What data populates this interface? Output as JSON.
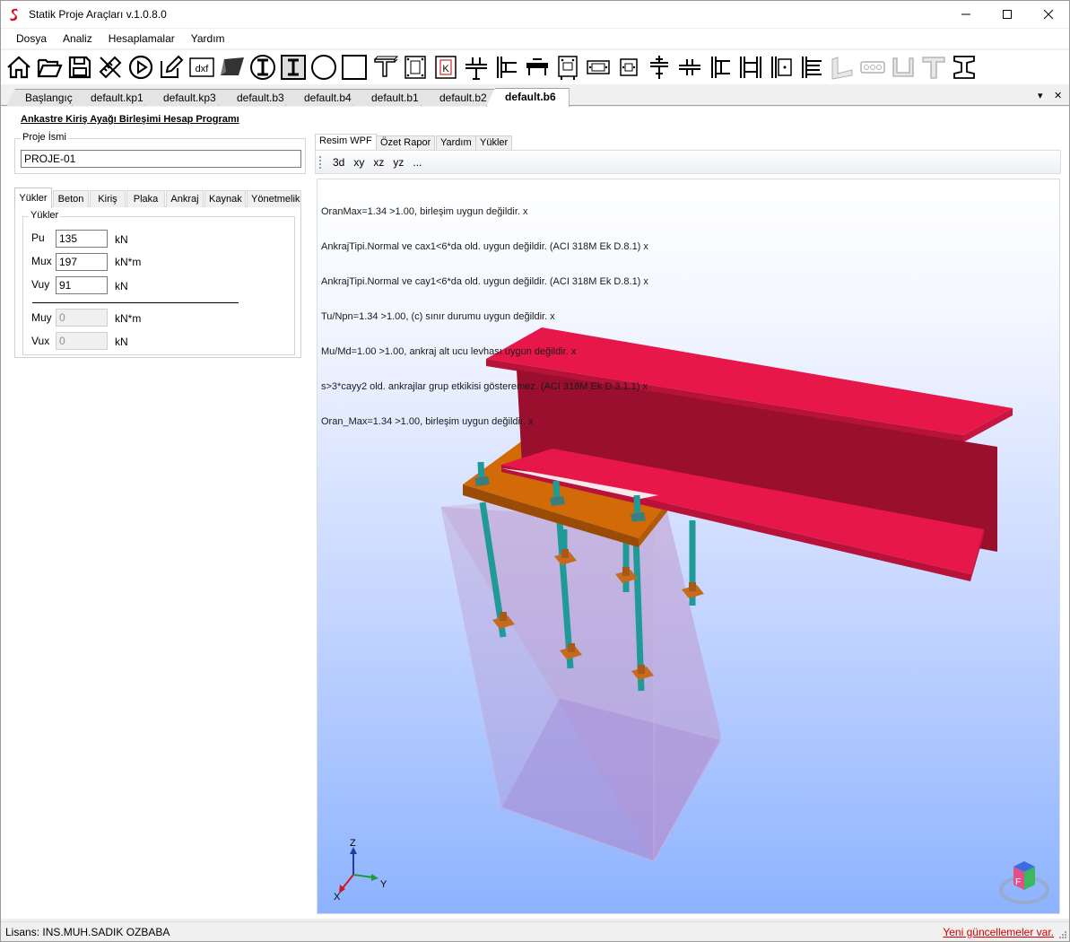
{
  "window": {
    "title": "Statik Proje Araçları v.1.0.8.0"
  },
  "colors": {
    "beam": "#e8174a",
    "beam_web": "#9b0f2e",
    "plate": "#d36a08",
    "bolt": "#1f9a96",
    "washer": "#c66b1e",
    "concrete": "#c8a0cc"
  },
  "menu": [
    "Dosya",
    "Analiz",
    "Hesaplamalar",
    "Yardım"
  ],
  "toolbar": {
    "icons": [
      "home-icon",
      "open-folder-icon",
      "save-icon",
      "ruler-pencil-icon",
      "play-icon",
      "edit-icon",
      "dxf-icon",
      "plate-3d-icon",
      "i-section-circle-icon",
      "i-section-square-icon",
      "circle-section-icon",
      "square-section-icon",
      "t-section-icon",
      "base-plate-icon",
      "column-base-k-icon",
      "beam-column-icon",
      "beam-end-plate-icon",
      "splice-icon",
      "bolt-plate-icon",
      "flange-plate-icon",
      "web-plate-icon",
      "shear-tab-icon",
      "double-angle-icon",
      "moment-connection-icon",
      "double-column-icon",
      "bracket-plate-icon",
      "stiffener-icon",
      "angle-icon",
      "bolt-group-icon",
      "channel-icon",
      "tee-icon",
      "i-beam-icon"
    ],
    "dxf_label": "dxf",
    "k_label": "K"
  },
  "doc_tabs": [
    "Başlangıç",
    "default.kp1",
    "default.kp3",
    "default.b3",
    "default.b4",
    "default.b1",
    "default.b2",
    "default.b6"
  ],
  "doc_tab_controls": {
    "dropdown": "▾",
    "close": "✕"
  },
  "left": {
    "program_title": "Ankastre Kiriş Ayağı Birleşimi Hesap Programı",
    "project_group_label": "Proje İsmi",
    "project_name": "PROJE-01",
    "tabs": [
      "Yükler",
      "Beton",
      "Kiriş",
      "Plaka",
      "Ankraj",
      "Kaynak",
      "Yönetmelik"
    ],
    "loads": {
      "group_label": "Yükler",
      "fields": [
        {
          "label": "Pu",
          "value": "135",
          "unit": "kN"
        },
        {
          "label": "Mux",
          "value": "197",
          "unit": "kN*m"
        },
        {
          "label": "Vuy",
          "value": "91",
          "unit": "kN"
        }
      ],
      "disabled_fields": [
        {
          "label": "Muy",
          "value": "0",
          "unit": "kN*m"
        },
        {
          "label": "Vux",
          "value": "0",
          "unit": "kN"
        }
      ]
    }
  },
  "right": {
    "tabs": [
      "Resim WPF",
      "Özet Rapor",
      "Yardım",
      "Yükler"
    ],
    "view_buttons": [
      "3d",
      "xy",
      "xz",
      "yz",
      "..."
    ],
    "messages": [
      "OranMax=1.34 >1.00, birleşim uygun değildir. x",
      "AnkrajTipi.Normal ve cax1<6*da old. uygun değildir. (ACI 318M Ek D.8.1) x",
      "AnkrajTipi.Normal ve cay1<6*da old. uygun değildir. (ACI 318M Ek D.8.1) x",
      "Tu/Npn=1.34 >1.00, (c) sınır durumu uygun değildir. x",
      "Mu/Md=1.00 >1.00, ankraj alt ucu levhası uygun değildir. x",
      "s>3*cayy2 old. ankrajlar grup etkikisi gösteremez. (ACI 318M Ek D.3.1.1) x",
      "Oran_Max=1.34 >1.00, birleşim uygun değildir. x"
    ],
    "axes": {
      "z": "Z",
      "x": "X",
      "y": "Y"
    },
    "view_cube_label": "F"
  },
  "status": {
    "license": "Lisans: INS.MUH.SADIK OZBABA",
    "updates": "Yeni güncellemeler var."
  }
}
